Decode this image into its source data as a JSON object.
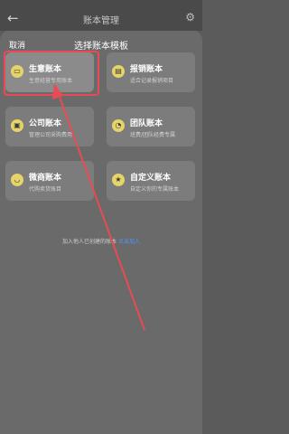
{
  "appbar": {
    "title": "账本管理",
    "back_icon": "back-arrow-icon",
    "settings_icon": "gear-icon"
  },
  "sheet": {
    "cancel": "取消",
    "title": "选择账本模板"
  },
  "cards": [
    {
      "title": "生意账本",
      "subtitle": "生意经营专用账本",
      "icon": "shop-icon",
      "glyph": "▭"
    },
    {
      "title": "报销账本",
      "subtitle": "适合记录报销项目",
      "icon": "receipt-icon",
      "glyph": "▤"
    },
    {
      "title": "公司账本",
      "subtitle": "管理公司采购费用",
      "icon": "bag-icon",
      "glyph": "▣"
    },
    {
      "title": "团队账本",
      "subtitle": "班费/团队经费专属",
      "icon": "team-icon",
      "glyph": "◔"
    },
    {
      "title": "微商账本",
      "subtitle": "代购卖货账目",
      "icon": "chat-icon",
      "glyph": "◡"
    },
    {
      "title": "自定义账本",
      "subtitle": "自定义你的专属账本",
      "icon": "star-icon",
      "glyph": "★"
    }
  ],
  "join": {
    "prefix": "加入他人已创建的账本",
    "link": "点击加入"
  },
  "colors": {
    "accent": "#e5d46a",
    "highlight": "#e84b55",
    "link": "#4a9bff"
  }
}
